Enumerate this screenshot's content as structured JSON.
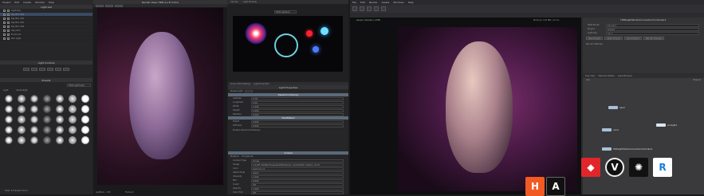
{
  "left_app": {
    "menu": [
      "Project",
      "Edit",
      "Create",
      "Window",
      "Help"
    ],
    "lights_header": "Light List",
    "lights": [
      "Light Ray",
      "Key Bdc 001",
      "Key Bdc 001",
      "Key Bdc 001",
      "Key Bdc 002",
      "Vary Rim",
      "Environm",
      "Rim Light"
    ],
    "light_control_header": "Light Controls",
    "presets_header": "Presets",
    "presets_dropdown": "HDR Lightmaps",
    "search_label": "Light",
    "category_label": "Studiolight",
    "footer_label": "Total: 8 Presets Found",
    "render_title": "Render View: HDR (Lo-Fi Color)",
    "render_status_left": "Lightbox · 150",
    "render_status_right": "Frame 0",
    "canvas_tab": "Canvas",
    "canvas_tab2": "Light Preview",
    "canvas_dropdown": "HDR Lightbox",
    "props_tabs": [
      "Scene Edit Settings",
      "Light Props Bar"
    ],
    "light_props_header": "Light Properties",
    "preset_label": "Preset Light",
    "transform_header": "Transform (Primary)",
    "props": [
      {
        "k": "Latitude",
        "v": "0.78"
      },
      {
        "k": "Longitude",
        "v": "0.06"
      },
      {
        "k": "Width",
        "v": "1.000"
      },
      {
        "k": "Height",
        "v": "1.000"
      },
      {
        "k": "Rotation",
        "v": "0.000"
      }
    ],
    "falloff_header": "Falloff/Blend",
    "falloff": [
      {
        "k": "Falloff",
        "v": "0.000"
      },
      {
        "k": "Softness",
        "v": "0.000"
      }
    ],
    "advanced_label": "Enable Advanced Features",
    "content_header": "Content",
    "content_tabs": [
      "Material",
      "Procedural"
    ],
    "content_rows": [
      {
        "k": "Content Type",
        "v": "Image"
      },
      {
        "k": "Image",
        "v": "C:/LIVE_PROJECTS/assets/HDR/Studio_Lights/HDRI_Softbox_01.tif"
      },
      {
        "k": "Color",
        "v": "Gamma 2.2"
      },
      {
        "k": "Alpha Mode",
        "v": "Alpha"
      },
      {
        "k": "Intensity",
        "v": "1.000"
      },
      {
        "k": "Blur",
        "v": "0.000"
      },
      {
        "k": "Invert",
        "v": "Off"
      },
      {
        "k": "Opacity",
        "v": "1.000"
      },
      {
        "k": "Color Tint",
        "v": "Off"
      }
    ]
  },
  "right_app": {
    "menu": [
      "File",
      "Edit",
      "Render",
      "Assets",
      "Windows",
      "Help"
    ],
    "viewport_header": "Scene View",
    "viewport_info_left": "persp1  |  Render  |  ACES",
    "viewport_info_right": "Memory: 124 MB  |  12 ms",
    "param_header": "HDRLightStudioConnectionController1",
    "param_fields": [
      {
        "k": "HDR Studio",
        "v": "Connect"
      },
      {
        "k": "Project",
        "v": "project"
      },
      {
        "k": "Light Rig",
        "v": "rig_1"
      }
    ],
    "param_buttons": [
      "New Project",
      "Open Project",
      "Save Project",
      "Render Preview"
    ],
    "param_section": "Render Settings",
    "network_tabs": [
      "Tree View",
      "Material Palette",
      "Asset Browser"
    ],
    "network_path": "/obj",
    "network_label": "Objects",
    "nodes": [
      "head",
      "cam1",
      "envlight1",
      "HDRLightStudioConnectionController1"
    ]
  },
  "logos": [
    {
      "name": "houdini-logo",
      "color": "#f15a22"
    },
    {
      "name": "arnold-logo",
      "color": "#111"
    },
    {
      "name": "redshift-logo",
      "color": "#e0262b"
    },
    {
      "name": "vray-logo",
      "color": "#111"
    },
    {
      "name": "octane-logo",
      "color": "#111"
    },
    {
      "name": "renderman-logo",
      "color": "#1a7cd8"
    }
  ]
}
